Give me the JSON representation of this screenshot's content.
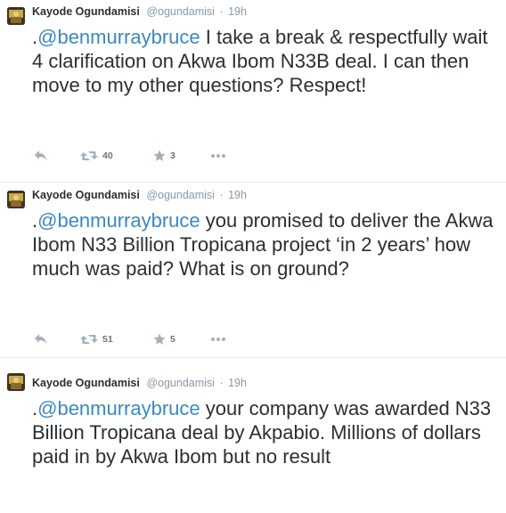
{
  "tweets": [
    {
      "fullname": "Kayode Ogundamisi",
      "username": "@ogundamisi",
      "separator": "·",
      "time": "19h",
      "text_prefix": ".",
      "mention": "@benmurraybruce",
      "text_rest": " I take a break & respectfully wait 4 clarification on Akwa Ibom N33B deal. I can then move to my other questions? Respect!",
      "retweet_count": "40",
      "favorite_count": "3",
      "more_label": "•••"
    },
    {
      "fullname": "Kayode Ogundamisi",
      "username": "@ogundamisi",
      "separator": "·",
      "time": "19h",
      "text_prefix": ".",
      "mention": "@benmurraybruce",
      "text_rest": " you promised to deliver the Akwa Ibom N33 Billion Tropicana project ‘in 2 years’ how much was paid? What is on ground?",
      "retweet_count": "51",
      "favorite_count": "5",
      "more_label": "•••"
    },
    {
      "fullname": "Kayode Ogundamisi",
      "username": "@ogundamisi",
      "separator": "·",
      "time": "19h",
      "text_prefix": ".",
      "mention": "@benmurraybruce",
      "text_rest": " your company was awarded N33 Billion Tropicana deal by Akpabio. Millions of dollars paid in by Akwa Ibom but no result"
    }
  ],
  "colors": {
    "mention": "#3b88c3",
    "meta": "#8899a6",
    "action_icon": "#a4b0ba",
    "text": "#292f33"
  },
  "icons": [
    "reply-icon",
    "retweet-icon",
    "favorite-icon",
    "more-icon"
  ]
}
